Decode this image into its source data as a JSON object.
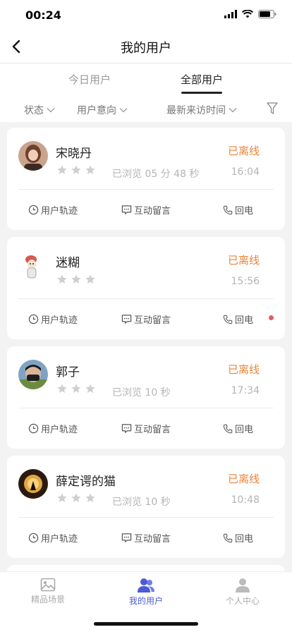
{
  "status_bar": {
    "time": "00:24"
  },
  "nav": {
    "title": "我的用户"
  },
  "tabs": [
    {
      "label": "今日用户",
      "active": false
    },
    {
      "label": "全部用户",
      "active": true
    }
  ],
  "filters": [
    {
      "label": "状态"
    },
    {
      "label": "用户意向"
    },
    {
      "label": "最新来访时间"
    }
  ],
  "users": [
    {
      "name": "宋晓丹",
      "state": "已离线",
      "rating": 3,
      "browse": "已浏览 05 分 48 秒",
      "time": "16:04",
      "avatar_color": "#8a5a44"
    },
    {
      "name": "迷糊",
      "state": "已离线",
      "rating": 3,
      "browse": "",
      "time": "15:56",
      "avatar_color": "#dddddd"
    },
    {
      "name": "郭子",
      "state": "已离线",
      "rating": 3,
      "browse": "已浏览 10 秒",
      "time": "17:34",
      "avatar_color": "#4c6f8c"
    },
    {
      "name": "薛定谔的猫",
      "state": "已离线",
      "rating": 3,
      "browse": "已浏览 10 秒",
      "time": "10:48",
      "avatar_color": "#3b2615"
    }
  ],
  "card_actions": {
    "track": "用户轨迹",
    "message": "互动留言",
    "call": "回电"
  },
  "tabbar": [
    {
      "label": "精品场景",
      "active": false,
      "icon": "image-icon"
    },
    {
      "label": "我的用户",
      "active": true,
      "icon": "users-icon"
    },
    {
      "label": "个人中心",
      "active": false,
      "icon": "person-icon"
    }
  ],
  "colors": {
    "accent": "#4a5cd6",
    "offline": "#e9843a",
    "unread_dot": "#e55d5d"
  }
}
